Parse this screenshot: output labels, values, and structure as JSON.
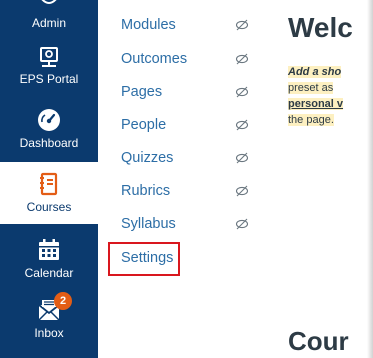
{
  "global_nav": {
    "admin": {
      "label": "Admin",
      "icon": "admin-icon"
    },
    "eps_portal": {
      "label": "EPS Portal",
      "icon": "eps-portal-icon"
    },
    "dashboard": {
      "label": "Dashboard",
      "icon": "dashboard-icon"
    },
    "courses": {
      "label": "Courses",
      "icon": "courses-icon",
      "active": true
    },
    "calendar": {
      "label": "Calendar",
      "icon": "calendar-icon"
    },
    "inbox": {
      "label": "Inbox",
      "icon": "inbox-icon",
      "badge": "2"
    }
  },
  "course_nav": {
    "items": [
      {
        "label": "Modules",
        "hidden": true
      },
      {
        "label": "Outcomes",
        "hidden": true
      },
      {
        "label": "Pages",
        "hidden": true
      },
      {
        "label": "People",
        "hidden": true
      },
      {
        "label": "Quizzes",
        "hidden": true
      },
      {
        "label": "Rubrics",
        "hidden": true
      },
      {
        "label": "Syllabus",
        "hidden": true
      },
      {
        "label": "Settings",
        "hidden": false,
        "highlighted": true
      }
    ]
  },
  "main": {
    "welcome_title": "Welc",
    "notice_lines": [
      "Add a sho",
      "preset as",
      "personal v",
      "the page."
    ],
    "course_title": "Cour"
  },
  "colors": {
    "nav_background": "#0b3a6e",
    "link": "#2d6ea6",
    "highlight_box": "#d9171e",
    "badge": "#e35d16",
    "notice_background": "#fdf0c1"
  }
}
